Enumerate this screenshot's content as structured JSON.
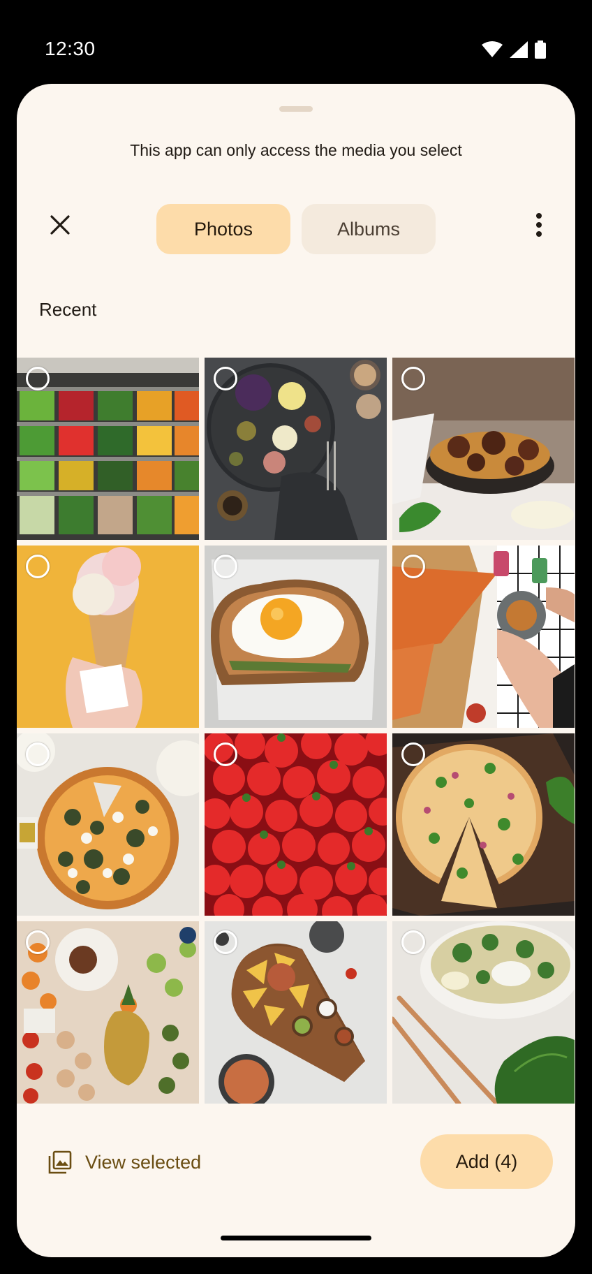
{
  "status": {
    "time": "12:30"
  },
  "picker": {
    "hint": "This app can only access the media you select",
    "tabs": {
      "photos": "Photos",
      "albums": "Albums"
    },
    "section": "Recent",
    "photos": [
      {
        "subject": "produce-shelf"
      },
      {
        "subject": "fruit-platter"
      },
      {
        "subject": "pasta-meatballs"
      },
      {
        "subject": "ice-cream-cone"
      },
      {
        "subject": "egg-toast"
      },
      {
        "subject": "pizza-table"
      },
      {
        "subject": "pizza-spinach"
      },
      {
        "subject": "strawberries"
      },
      {
        "subject": "pizza-board"
      },
      {
        "subject": "grocery-spread"
      },
      {
        "subject": "nachos-board"
      },
      {
        "subject": "salad-bowl"
      }
    ],
    "bottom": {
      "view_selected": "View selected",
      "add": "Add (4)"
    }
  },
  "colors": {
    "accent": "#fddcaa",
    "sheet": "#fcf6ef",
    "link": "#6a4d12"
  },
  "icons": [
    "close-icon",
    "more-vert-icon",
    "image-stack-icon",
    "wifi-icon",
    "signal-icon",
    "battery-icon"
  ]
}
